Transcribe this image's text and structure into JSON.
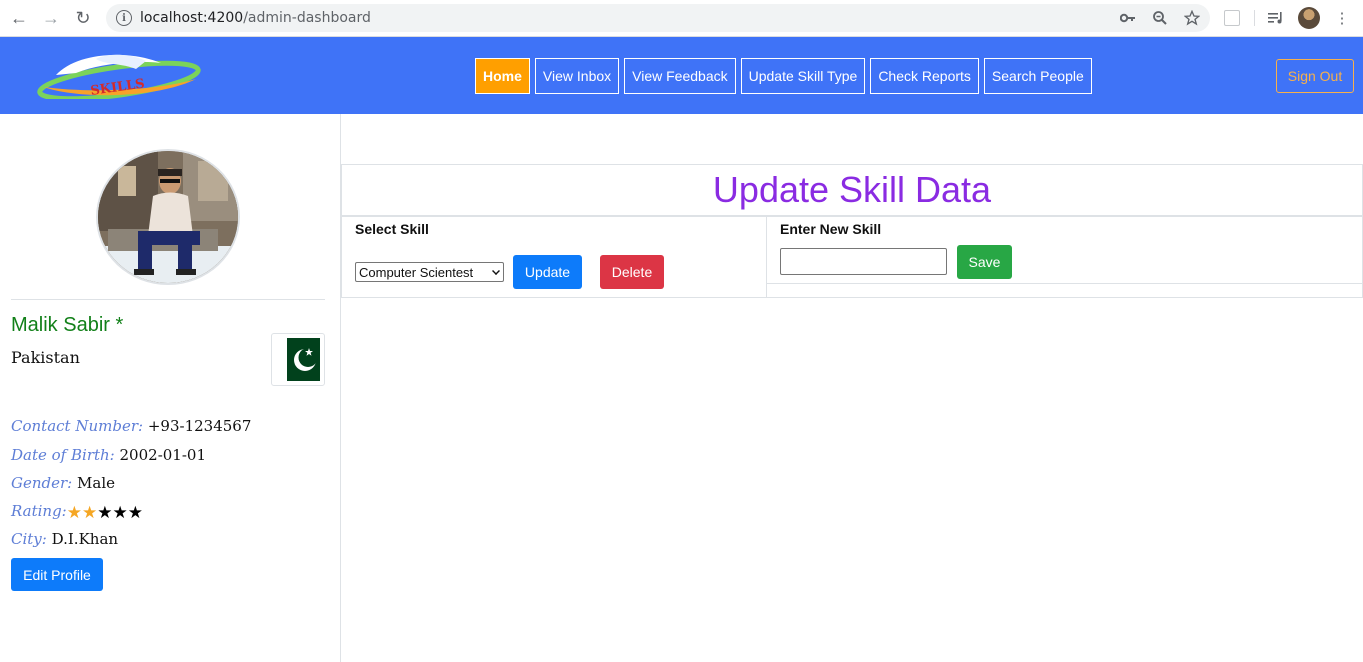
{
  "browser": {
    "url_host": "localhost:4200",
    "url_path": "/admin-dashboard"
  },
  "navbar": {
    "logo_text": "SKILLS",
    "links": [
      "Home",
      "View Inbox",
      "View Feedback",
      "Update Skill Type",
      "Check Reports",
      "Search People"
    ],
    "active_link": "Home",
    "signout_label": "Sign Out"
  },
  "profile": {
    "name": "Malik Sabir *",
    "country": "Pakistan",
    "contact_label": "Contact Number:",
    "contact_value": "+93-1234567",
    "dob_label": "Date of Birth:",
    "dob_value": "2002-01-01",
    "gender_label": "Gender:",
    "gender_value": "Male",
    "rating_label": "Rating:",
    "rating_value": 2,
    "rating_max": 5,
    "city_label": "City:",
    "city_value": "D.I.Khan",
    "edit_label": "Edit Profile"
  },
  "main": {
    "title": "Update Skill Data",
    "select_skill_label": "Select Skill",
    "selected_skill": "Computer Scientest",
    "update_label": "Update",
    "delete_label": "Delete",
    "new_skill_label": "Enter New Skill",
    "new_skill_value": "",
    "save_label": "Save"
  },
  "colors": {
    "navbar": "#3f73f7",
    "active_nav": "#ff9f00",
    "title": "#8a2be2",
    "name": "#128019",
    "star_filled": "#f5a623",
    "star_empty": "#000000"
  }
}
